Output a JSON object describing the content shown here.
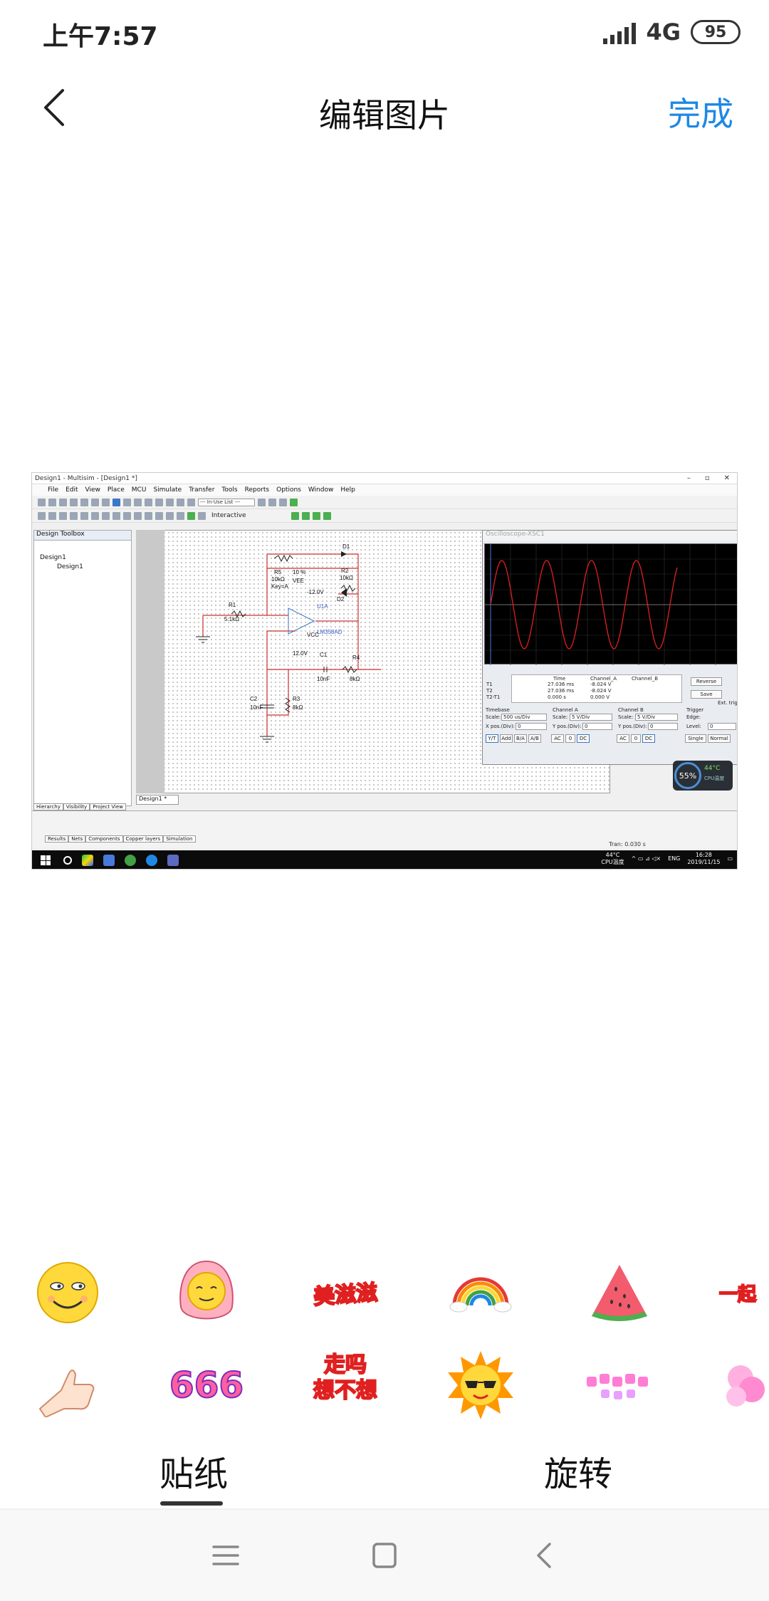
{
  "status_bar": {
    "time": "上午7:57",
    "network": "4G",
    "battery": "95"
  },
  "header": {
    "title": "编辑图片",
    "done_label": "完成"
  },
  "screenshot": {
    "window_title": "Design1 - Multisim - [Design1 *]",
    "menu": [
      "File",
      "Edit",
      "View",
      "Place",
      "MCU",
      "Simulate",
      "Transfer",
      "Tools",
      "Reports",
      "Options",
      "Window",
      "Help"
    ],
    "inuse_list": "--- In-Use List ---",
    "interactive_label": "Interactive",
    "toolbox_title": "Design Toolbox",
    "tree_root": "Design1",
    "tree_child": "Design1",
    "toolbox_tabs": [
      "Hierarchy",
      "Visibility",
      "Project View"
    ],
    "components": {
      "r5": "R5",
      "r5_val": "10kΩ",
      "r5_key": "Key=A",
      "r5_pct": "10 %",
      "vee": "VEE",
      "vee_val": "-12.0V",
      "d1": "D1",
      "r2": "R2",
      "r2_val": "10kΩ",
      "d2": "D2",
      "u1a": "U1A",
      "r1": "R1",
      "r1_val": "5.1kΩ",
      "chip": "LM358AD",
      "vcc": "VCC",
      "vcc_val": "12.0V",
      "c1": "C1",
      "c1_val": "10nF",
      "r4": "R4",
      "r4_val": "8kΩ",
      "c2": "C2",
      "c2_val": "10nF",
      "r3": "R3",
      "r3_val": "8kΩ"
    },
    "scope": {
      "title": "Oscilloscope-XSC1",
      "headers": [
        "Time",
        "Channel_A",
        "Channel_B"
      ],
      "rows": [
        {
          "label": "T1",
          "time": "27.036 ms",
          "a": "-8.024 V"
        },
        {
          "label": "T2",
          "time": "27.036 ms",
          "a": "-8.024 V"
        },
        {
          "label": "T2-T1",
          "time": "0.000 s",
          "a": "0.000 V"
        }
      ],
      "reverse": "Reverse",
      "save": "Save",
      "ext_trig": "Ext. trig",
      "timebase_label": "Timebase",
      "scale_label": "Scale:",
      "timebase_scale": "500 us/Div",
      "xpos_label": "X pos.(Div):",
      "xpos": "0",
      "chA_label": "Channel A",
      "chA_scale": "5  V/Div",
      "ypos_label": "Y pos.(Div):",
      "chA_ypos": "0",
      "chB_label": "Channel B",
      "chB_scale": "5  V/Div",
      "chB_ypos": "0",
      "trigger_label": "Trigger",
      "edge_label": "Edge:",
      "level_label": "Level:",
      "level": "0",
      "mode_buttons": [
        "Y/T",
        "Add",
        "B/A",
        "A/B"
      ],
      "coupling": [
        "AC",
        "0",
        "DC"
      ],
      "single": "Single",
      "normal": "Normal"
    },
    "cpu": {
      "usage": "55%",
      "temp": "44°C",
      "label": "CPU温度"
    },
    "canvas_tab": "Design1 *",
    "sheet_tabs": [
      "Results",
      "Nets",
      "Components",
      "Copper layers",
      "Simulation"
    ],
    "tran": "Tran: 0.030 s",
    "tray": {
      "temp": "44°C",
      "temp_label": "CPU温度",
      "lang": "ENG",
      "clock": "16:28",
      "date": "2019/11/15"
    }
  },
  "tabs": {
    "sticker": "贴纸",
    "rotate": "旋转"
  },
  "stickers": {
    "meizizi": "美滋滋",
    "yiqi": "一起",
    "num666": "666",
    "zouzou": "走吗",
    "zouzou2": "想不想"
  },
  "colors": {
    "accent": "#1e88e5",
    "wave": "#e02020"
  }
}
